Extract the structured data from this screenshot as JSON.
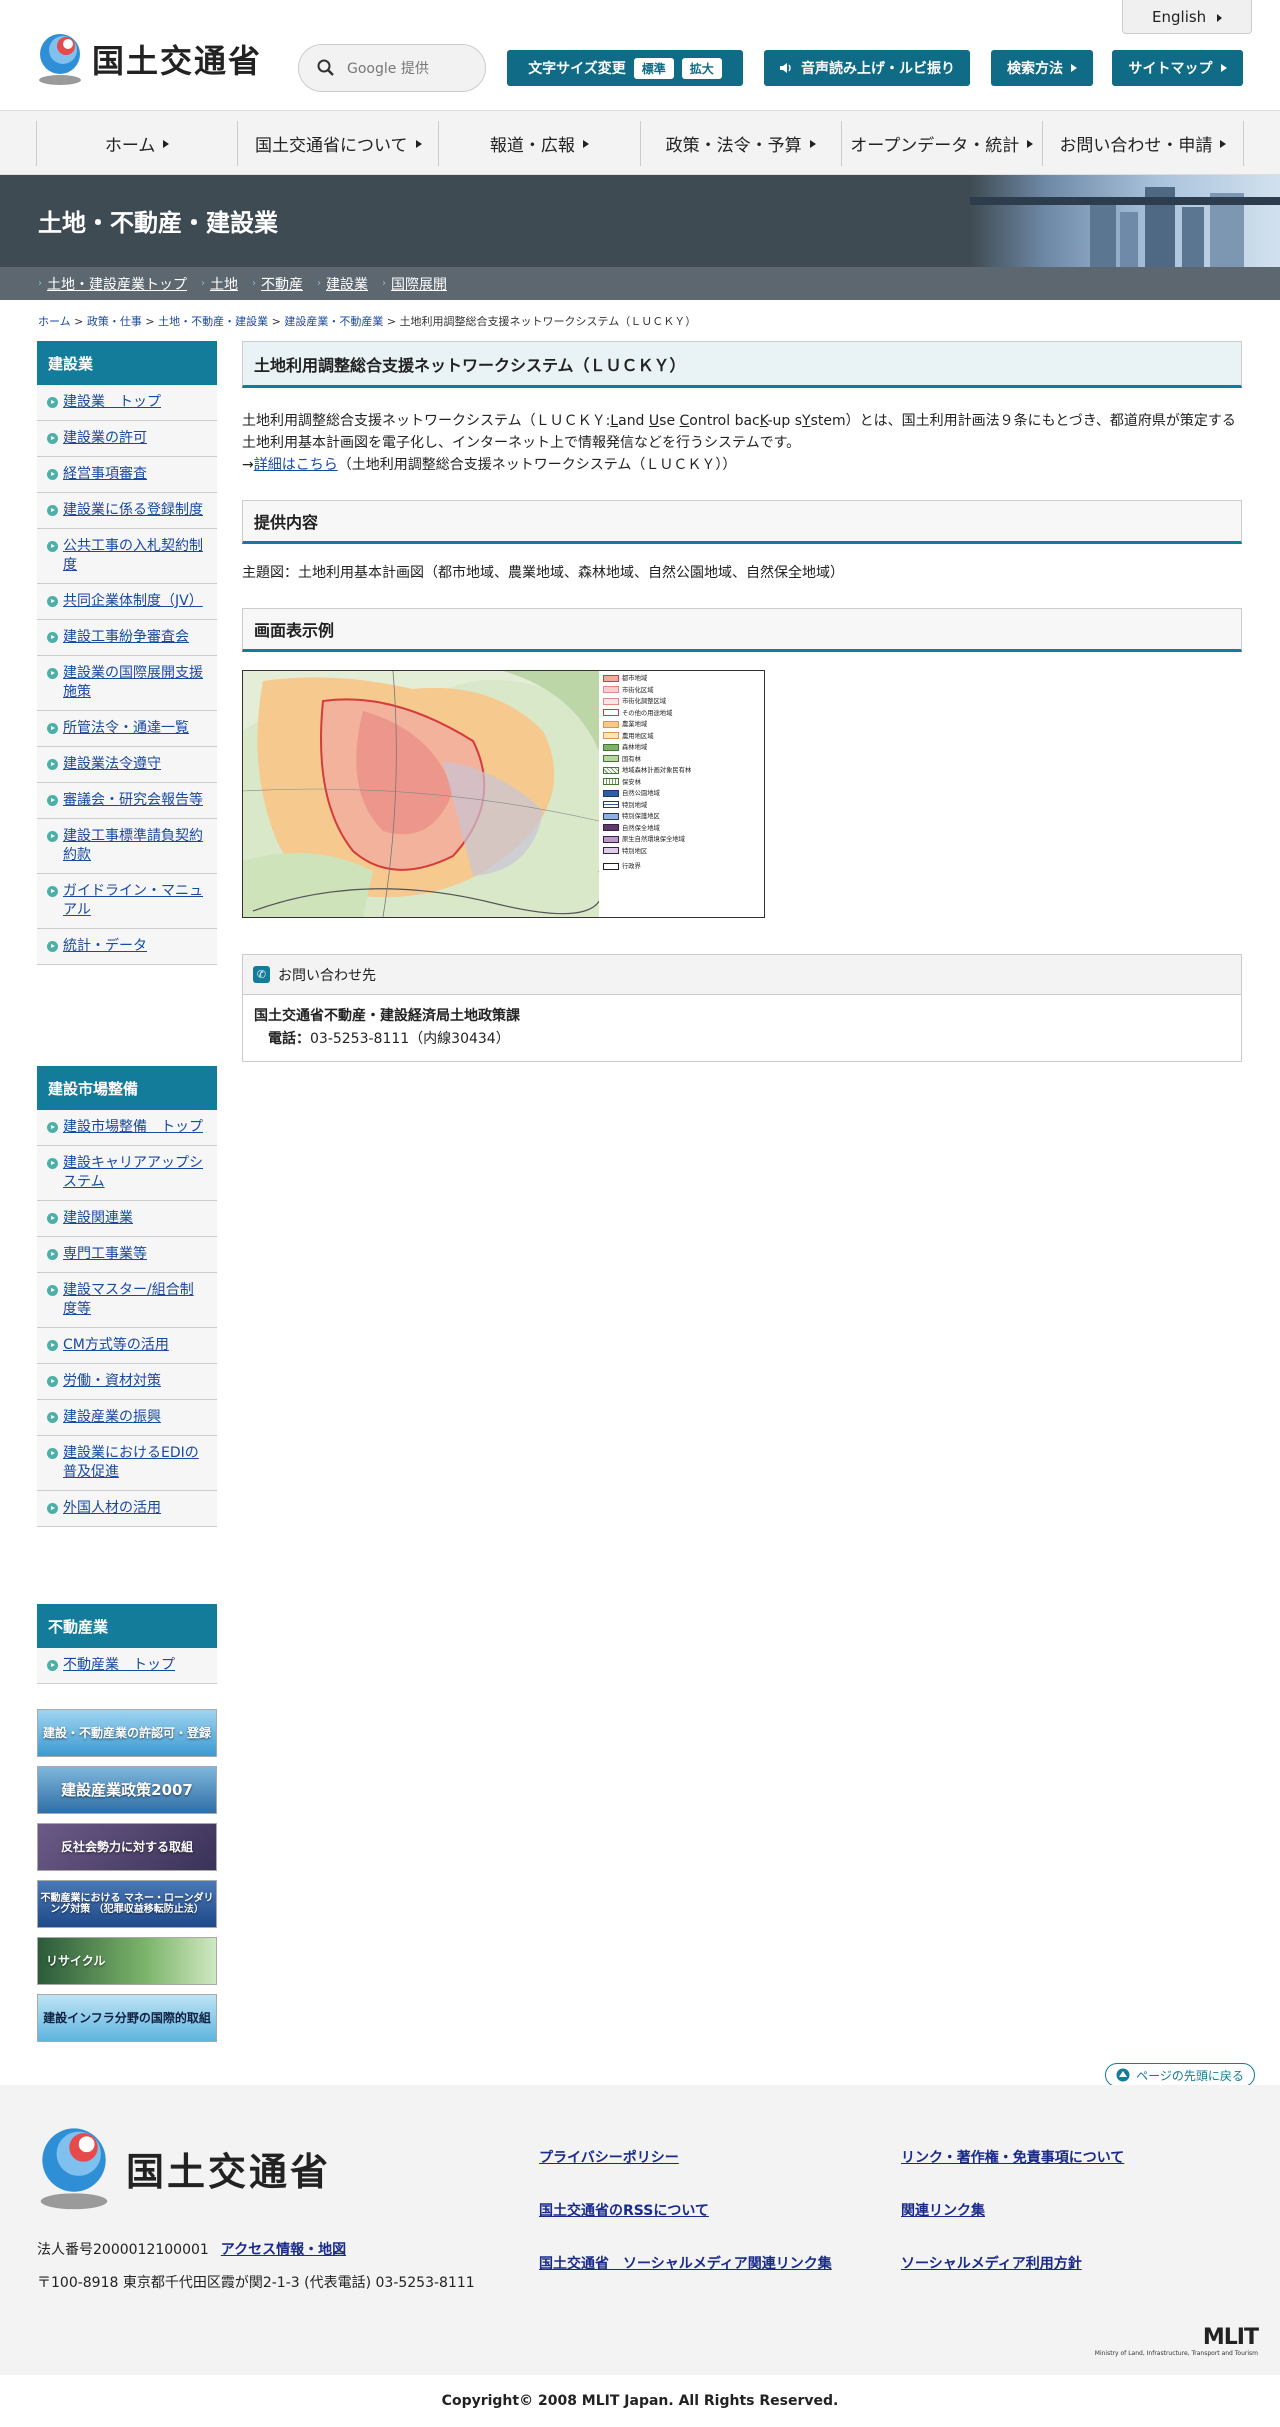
{
  "header": {
    "logo_text": "国土交通省",
    "english": "English",
    "search_placeholder": "Google 提供",
    "font_size": {
      "label": "文字サイズ変更",
      "normal": "標準",
      "large": "拡大"
    },
    "voice": "音声読み上げ・ルビ振り",
    "search_method": "検索方法",
    "sitemap": "サイトマップ"
  },
  "nav": [
    "ホーム",
    "国土交通省について",
    "報道・広報",
    "政策・法令・予算",
    "オープンデータ・統計",
    "お問い合わせ・申請"
  ],
  "banner": {
    "title": "土地・不動産・建設業"
  },
  "subnav": [
    "土地・建設産業トップ",
    "土地",
    "不動産",
    "建設業",
    "国際展開"
  ],
  "breadcrumb": {
    "items": [
      "ホーム",
      "政策・仕事",
      "土地・不動産・建設業",
      "建設産業・不動産業"
    ],
    "current": "土地利用調整総合支援ネットワークシステム（ＬＵＣＫＹ）",
    "sep": ">"
  },
  "sidebar": {
    "group1": {
      "title": "建設業",
      "items": [
        "建設業　トップ",
        "建設業の許可",
        "経営事項審査",
        "建設業に係る登録制度",
        "公共工事の入札契約制度",
        "共同企業体制度（JV）",
        "建設工事紛争審査会",
        "建設業の国際展開支援施策",
        "所管法令・通達一覧",
        "建設業法令遵守",
        "審議会・研究会報告等",
        "建設工事標準請負契約約款",
        "ガイドライン・マニュアル",
        "統計・データ"
      ]
    },
    "group2": {
      "title": "建設市場整備",
      "items": [
        "建設市場整備　トップ",
        "建設キャリアアップシステム",
        "建設関連業",
        "専門工事業等",
        "建設マスター/組合制度等",
        "CM方式等の活用",
        "労働・資材対策",
        "建設産業の振興",
        "建設業におけるEDIの普及促進",
        "外国人材の活用"
      ]
    },
    "group3": {
      "title": "不動産業",
      "items": [
        "不動産業　トップ"
      ]
    },
    "banners": [
      "建設・不動産業の許認可・登録",
      "建設産業政策2007",
      "反社会勢力に対する取組",
      "不動産業における マネー・ローンダリング対策 （犯罪収益移転防止法）",
      "リサイクル",
      "建設インフラ分野の国際的取組"
    ]
  },
  "main": {
    "title": "土地利用調整総合支援ネットワークシステム（ＬＵＣＫＹ）",
    "intro_prefix": "土地利用調整総合支援ネットワークシステム（ＬＵＣＫＹ:",
    "intro_acronym": [
      "L",
      "and ",
      "U",
      "se ",
      "C",
      "ontrol bac",
      "K",
      "-up s",
      "Y",
      "stem"
    ],
    "intro_suffix": "）とは、国土利用計画法９条にもとづき、都道府県が策定する土地利用基本計画図を電子化し、インターネット上で情報発信などを行うシステムです。",
    "detail_arrow": "→",
    "detail_link": "詳細はこちら",
    "detail_suffix": "（土地利用調整総合支援ネットワークシステム（ＬＵＣＫＹ））",
    "provide_heading": "提供内容",
    "provide_text": "主題図：土地利用基本計画図（都市地域、農業地域、森林地域、自然公園地域、自然保全地域）",
    "example_heading": "画面表示例",
    "legend": [
      "都市地域",
      "市街化区域",
      "市街化調整区域",
      "その他の用途地域",
      "農業地域",
      "農用地区域",
      "森林地域",
      "国有林",
      "地域森林計画対象民有林",
      "保安林",
      "自然公園地域",
      "特別地域",
      "特別保護地区",
      "自然保全地域",
      "原生自然環境保全地域",
      "特別地区",
      "行政界"
    ],
    "contact": {
      "heading": "お問い合わせ先",
      "org": "国土交通省不動産・建設経済局土地政策課",
      "tel_label": "電話：",
      "tel": "03-5253-8111（内線30434）"
    }
  },
  "to_top": "ページの先頭に戻る",
  "footer": {
    "logo_text": "国土交通省",
    "corp_no": "法人番号2000012100001",
    "access": "アクセス情報・地図",
    "address": "〒100-8918 東京都千代田区霞が関2-1-3 (代表電話) 03-5253-8111",
    "links": [
      "プライバシーポリシー",
      "リンク・著作権・免責事項について",
      "国土交通省のRSSについて",
      "関連リンク集",
      "国土交通省　ソーシャルメディア関連リンク集",
      "ソーシャルメディア利用方針"
    ],
    "mlit": "MLIT",
    "mlit_sub": "Ministry of Land, Infrastructure, Transport and Tourism",
    "copyright": "Copyright© 2008 MLIT Japan. All Rights Reserved."
  },
  "colors": {
    "teal": "#137c9a",
    "banner": "#3f4b53"
  }
}
